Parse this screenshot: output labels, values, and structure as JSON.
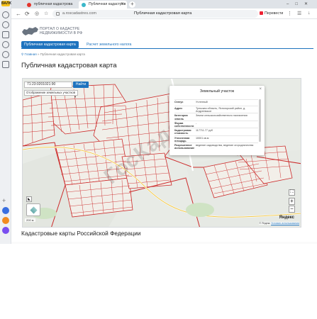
{
  "sidebar": {
    "badge": "ВАЛЮ"
  },
  "tabs": [
    {
      "label": "публичная кадастрова",
      "icon": "yandex-red-icon"
    },
    {
      "label": "Публичная кадастров",
      "icon": "kadastr-icon"
    }
  ],
  "address": {
    "url": "a.roscadastres.com",
    "page_title": "Публичная кадастровая карта",
    "translate": "Перевести"
  },
  "portal": {
    "name_line1": "ПОРТАЛ О КАДАСТРЕ",
    "name_line2": "НЕДВИЖИМОСТИ В РФ"
  },
  "nav": {
    "tab1": "Публичная кадастровая карта",
    "tab2": "Расчет земельного налога"
  },
  "breadcrumb": {
    "home": "Главная",
    "sep": "»",
    "current": "Публичная кадастровая карта"
  },
  "heading": "Публичная кадастровая карта",
  "map": {
    "search_value": "71:23:0201021:90",
    "search_button": "Найти",
    "layer_select": "Отображение  земельных участков",
    "scale": "200 м",
    "yandex": "Яндекс",
    "copyright": "© Яндекс",
    "terms": "Условия использования",
    "watermark": "ГосКадастр"
  },
  "popup": {
    "title": "Земельный участок",
    "rows": [
      {
        "k": "Статус",
        "v": "Учтенный"
      },
      {
        "k": "Адрес",
        "v": "Тульская область, Ясногорский район, д. Андреевское"
      },
      {
        "k": "Категория земель",
        "v": "Земли сельскохозяйственного назначения"
      },
      {
        "k": "Форма собственности",
        "v": "-"
      },
      {
        "k": "Кадастровая стоимость",
        "v": "117711.77 руб"
      },
      {
        "k": "Уточненная площадь",
        "v": "10001 кв.м"
      },
      {
        "k": "Разрешенное использование",
        "v": "ведение садоводства, ведение огородничества"
      }
    ]
  },
  "heading2": "Кадастровые карты Российской Федерации"
}
